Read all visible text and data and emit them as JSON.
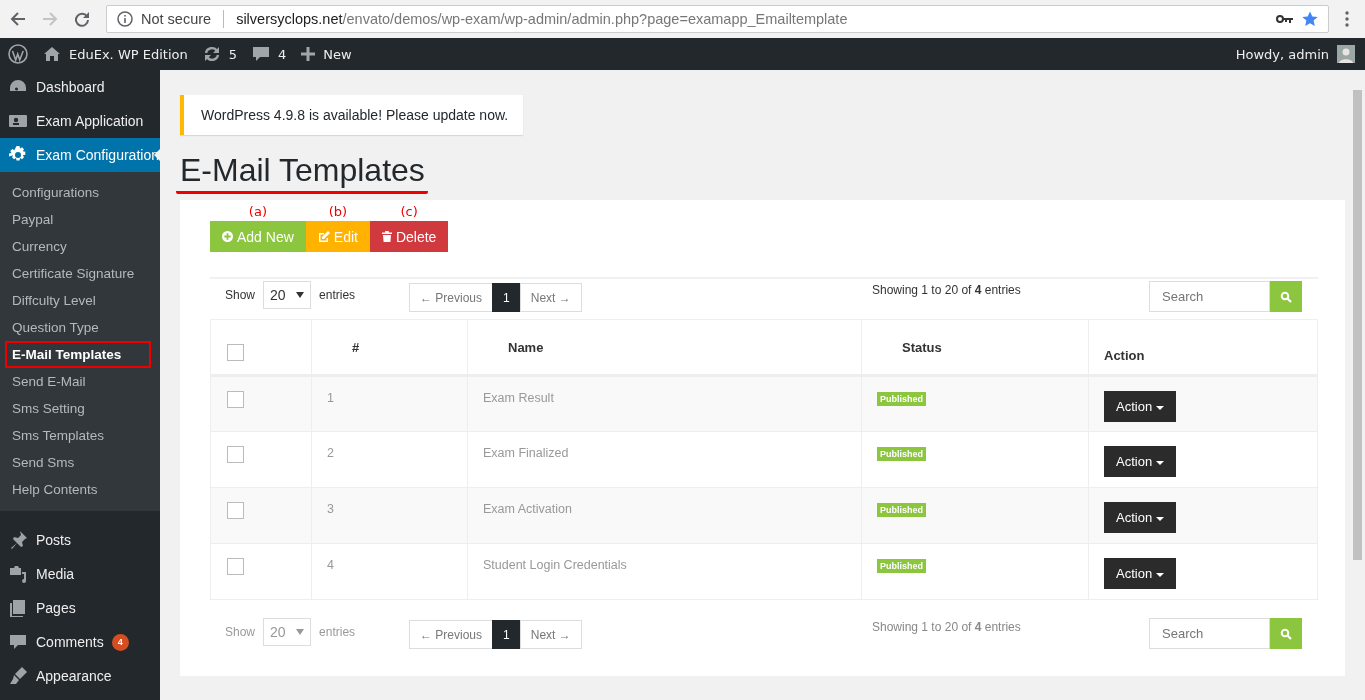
{
  "browser": {
    "security": "Not secure",
    "url_host": "silversyclops.net",
    "url_path": "/envato/demos/wp-exam/wp-admin/admin.php?page=examapp_Emailtemplate"
  },
  "admin_bar": {
    "site": "EduEx. WP Edition",
    "updates": "5",
    "comments": "4",
    "new": "New",
    "greeting": "Howdy, admin"
  },
  "sidebar": {
    "items": [
      {
        "label": "Dashboard",
        "selected": false
      },
      {
        "label": "Exam Application",
        "selected": false
      },
      {
        "label": "Exam Configuration",
        "selected": true,
        "children": [
          {
            "label": "Configurations",
            "selected": false,
            "annotated": false
          },
          {
            "label": "Paypal",
            "selected": false,
            "annotated": false
          },
          {
            "label": "Currency",
            "selected": false,
            "annotated": false
          },
          {
            "label": "Certificate Signature",
            "selected": false,
            "annotated": false
          },
          {
            "label": "Diffculty Level",
            "selected": false,
            "annotated": false
          },
          {
            "label": "Question Type",
            "selected": false,
            "annotated": false
          },
          {
            "label": "E-Mail Templates",
            "selected": true,
            "annotated": true
          },
          {
            "label": "Send E-Mail",
            "selected": false,
            "annotated": false
          },
          {
            "label": "Sms Setting",
            "selected": false,
            "annotated": false
          },
          {
            "label": "Sms Templates",
            "selected": false,
            "annotated": false
          },
          {
            "label": "Send Sms",
            "selected": false,
            "annotated": false
          },
          {
            "label": "Help Contents",
            "selected": false,
            "annotated": false
          }
        ]
      },
      {
        "label": "Posts",
        "selected": false
      },
      {
        "label": "Media",
        "selected": false
      },
      {
        "label": "Pages",
        "selected": false
      },
      {
        "label": "Comments",
        "selected": false,
        "badge": "4"
      },
      {
        "label": "Appearance",
        "selected": false
      }
    ]
  },
  "notice": "WordPress 4.9.8 is available! Please update now.",
  "title": "E-Mail Templates",
  "title_underlined": true,
  "toolbar": [
    {
      "kind": "add",
      "label": "Add New",
      "annotation": "(a)"
    },
    {
      "kind": "edit",
      "label": "Edit",
      "annotation": "(b)"
    },
    {
      "kind": "delete",
      "label": "Delete",
      "annotation": "(c)"
    }
  ],
  "table_controls": [
    {
      "disabled": false,
      "show_label": "Show",
      "page_size": "20",
      "entries_label": "entries",
      "pages": [
        {
          "label": "← Previous",
          "selected": false
        },
        {
          "label": "1",
          "selected": true
        },
        {
          "label": "Next →",
          "selected": false
        }
      ],
      "info": "Showing 1 to 20 of **4** entries",
      "search_placeholder": "Search"
    },
    {
      "disabled": true,
      "show_label": "Show",
      "page_size": "20",
      "entries_label": "entries",
      "pages": [
        {
          "label": "← Previous",
          "selected": false
        },
        {
          "label": "1",
          "selected": true
        },
        {
          "label": "Next →",
          "selected": false
        }
      ],
      "info": "Showing 1 to 20 of **4** entries",
      "search_placeholder": "Search"
    }
  ],
  "table": {
    "header_checked": false,
    "columns": [
      "#",
      "Name",
      "Status",
      "Action"
    ],
    "rows": [
      {
        "checked": false,
        "number": "1",
        "name": "Exam Result",
        "status": "Published",
        "action": "Action"
      },
      {
        "checked": false,
        "number": "2",
        "name": "Exam Finalized",
        "status": "Published",
        "action": "Action"
      },
      {
        "checked": false,
        "number": "3",
        "name": "Exam Activation",
        "status": "Published",
        "action": "Action"
      },
      {
        "checked": false,
        "number": "4",
        "name": "Student Login Credentials",
        "status": "Published",
        "action": "Action"
      }
    ]
  }
}
